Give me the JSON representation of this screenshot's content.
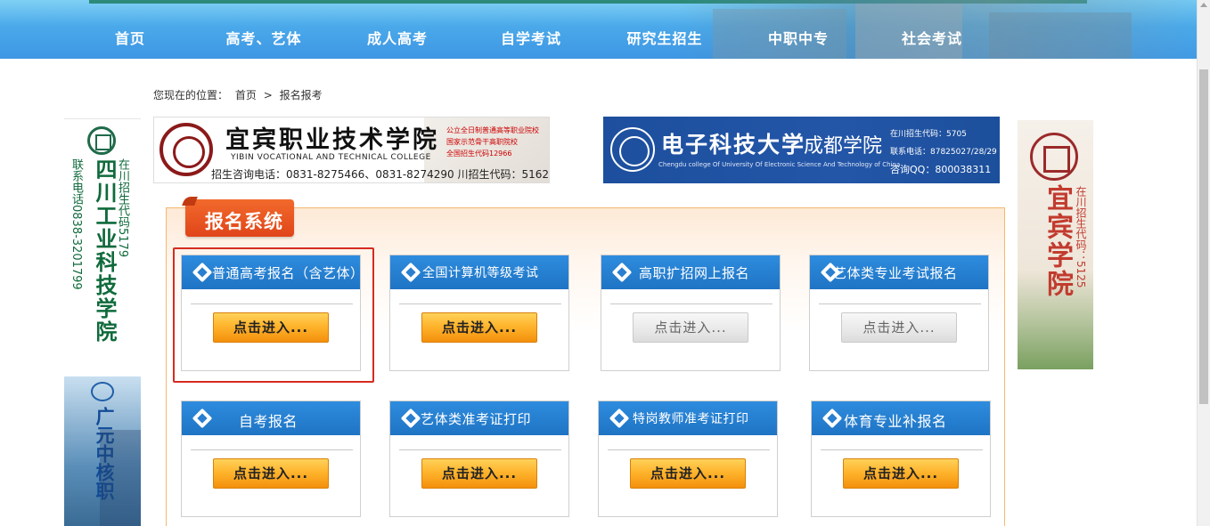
{
  "nav": {
    "items": [
      {
        "label": "首页"
      },
      {
        "label": "高考、艺体"
      },
      {
        "label": "成人高考"
      },
      {
        "label": "自学考试"
      },
      {
        "label": "研究生招生"
      },
      {
        "label": "中职中专"
      },
      {
        "label": "社会考试"
      }
    ]
  },
  "breadcrumb": {
    "prefix": "您现在的位置：",
    "home": "首页",
    "separator": ">",
    "current": "报名报考"
  },
  "banners": {
    "yibin": {
      "title": "宜宾职业技术学院",
      "english": "YIBIN VOCATIONAL AND TECHNICAL COLLEGE",
      "red_lines": [
        "公立全日制普通高等职业院校",
        "国家示范骨干高职院校",
        "全国招生代码12966"
      ],
      "hotline": "招生咨询电话：0831-8275466、0831-8274290 川招生代码：5162"
    },
    "uestc": {
      "title": "电子科技大学",
      "subtitle": "成都学院",
      "english": "Chengdu college Of University Of Electronic Science And Technology of China",
      "info": [
        "在川招生代码：5705",
        "联系电话：87825027/28/29",
        "咨询QQ：800038311"
      ]
    },
    "left_top": {
      "name": "四川工业科技学院",
      "phone": "联系电话0838-3201799",
      "code": "在川招生代码5179"
    },
    "left_bottom": {
      "name": "广元中核职"
    },
    "right": {
      "name": "宜宾学院",
      "code": "在川招生代码：5125"
    }
  },
  "panel": {
    "title": "报名系统",
    "cards": [
      {
        "label": "普通高考报名（含艺体）",
        "button": "点击进入...",
        "enabled": true
      },
      {
        "label": "全国计算机等级考试",
        "button": "点击进入...",
        "enabled": true
      },
      {
        "label": "高职扩招网上报名",
        "button": "点击进入...",
        "enabled": false
      },
      {
        "label": "艺体类专业考试报名",
        "button": "点击进入...",
        "enabled": false
      },
      {
        "label": "自考报名",
        "button": "点击进入...",
        "enabled": true
      },
      {
        "label": "艺体类准考证打印",
        "button": "点击进入...",
        "enabled": true
      },
      {
        "label": "特岗教师准考证打印",
        "button": "点击进入...",
        "enabled": true
      },
      {
        "label": "体育专业补报名",
        "button": "点击进入...",
        "enabled": true
      }
    ]
  },
  "colors": {
    "nav_blue": "#3e96e4",
    "card_head_blue": "#2e8cde",
    "button_orange": "#ffb42d",
    "panel_tag": "#e0451a",
    "highlight_red": "#d62b20"
  }
}
